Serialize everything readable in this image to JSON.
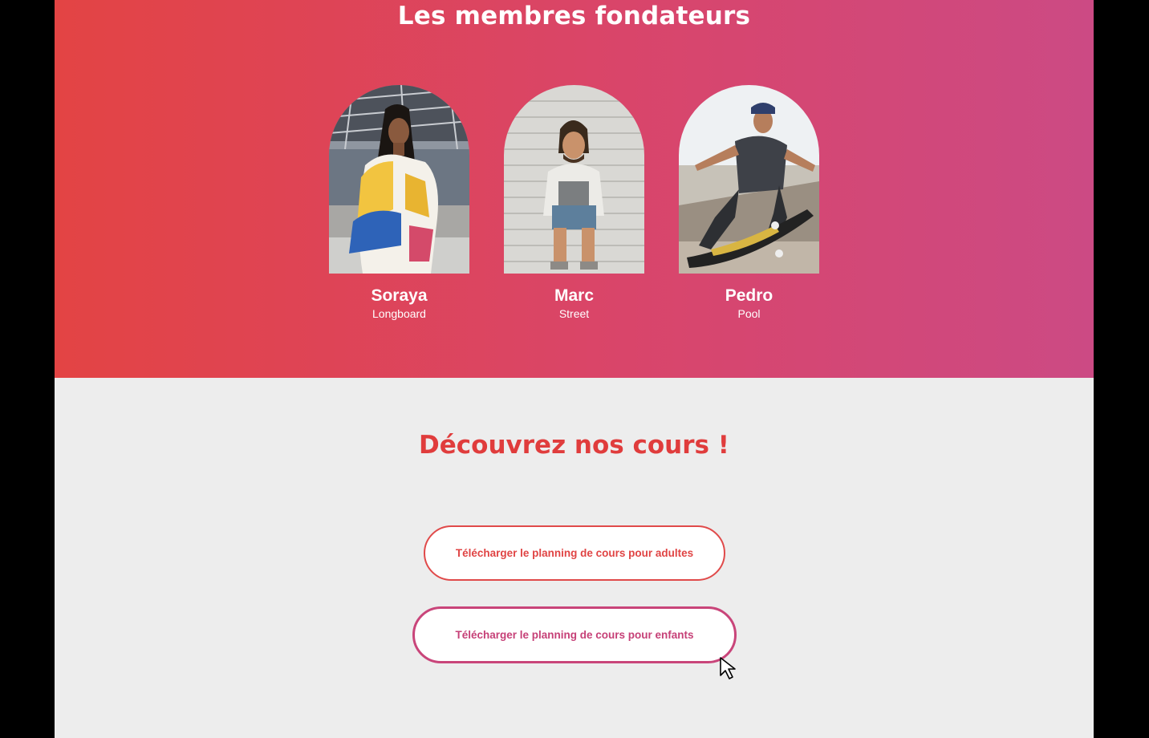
{
  "founders_section": {
    "title": "Les membres fondateurs",
    "members": [
      {
        "name": "Soraya",
        "discipline": "Longboard",
        "photo": "portrait-photo"
      },
      {
        "name": "Marc",
        "discipline": "Street",
        "photo": "portrait-photo"
      },
      {
        "name": "Pedro",
        "discipline": "Pool",
        "photo": "skateboarding-photo"
      }
    ]
  },
  "courses_section": {
    "title": "Découvrez nos cours !",
    "buttons": {
      "adults_label": "Télécharger le planning de cours pour adultes",
      "kids_label": "Télécharger le planning de cours pour enfants"
    }
  },
  "colors": {
    "gradient_start": "#e34444",
    "gradient_end": "#cc4a84",
    "accent_red": "#e03c3c",
    "accent_pink": "#c9457a",
    "background": "#ededed"
  },
  "pointer": "arrow-cursor-icon"
}
